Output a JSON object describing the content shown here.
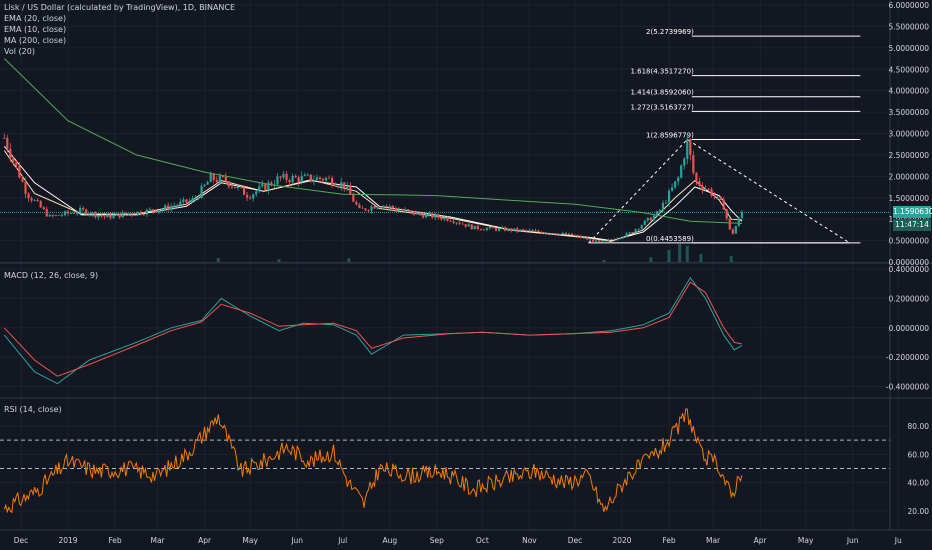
{
  "header": {
    "lines": [
      "Lisk / US Dollar (calculated by TradingView), 1D, BINANCE",
      "EMA (20, close)",
      "EMA (10, close)",
      "MA (200, close)",
      "Vol (20)"
    ]
  },
  "price_labels": {
    "last_price": "1.1590630",
    "countdown": "11:47:14"
  },
  "colors": {
    "background": "#131722",
    "grid": "#1e2230",
    "separator": "#363a45",
    "text": "#d1d4dc",
    "up": "#26a69a",
    "down": "#ef5350",
    "ema20": "#ffffff",
    "ema10": "#ffe0b2",
    "ma200": "#4caf50",
    "macd_line": "#26a69a",
    "signal_line": "#ef5350",
    "rsi_line": "#f57c00",
    "last_price_bg": "#26a69a",
    "countdown_bg": "#1e5c56"
  },
  "chart_data": [
    {
      "type": "candlestick",
      "title": "Lisk / US Dollar (calculated by TradingView), 1D, BINANCE",
      "x_tick_labels": [
        "Dec",
        "2019",
        "Feb",
        "Mar",
        "Apr",
        "May",
        "Jun",
        "Jul",
        "Aug",
        "Sep",
        "Oct",
        "Nov",
        "Dec",
        "2020",
        "Feb",
        "Mar",
        "Apr",
        "May",
        "Jun",
        "Ju"
      ],
      "y_tick_labels": [
        "6.0000000",
        "5.5000000",
        "5.0000000",
        "4.5000000",
        "4.0000000",
        "3.5000000",
        "3.0000000",
        "2.5000000",
        "2.0000000",
        "1.5000000",
        "1.0000000",
        "0.5000000",
        "0.0000000"
      ],
      "ylim": [
        0,
        6.0
      ],
      "price_path": [
        {
          "x": "2018-11-20",
          "y": 2.9
        },
        {
          "x": "2018-12-05",
          "y": 1.6
        },
        {
          "x": "2018-12-20",
          "y": 1.05
        },
        {
          "x": "2019-01-10",
          "y": 1.2
        },
        {
          "x": "2019-01-25",
          "y": 1.05
        },
        {
          "x": "2019-02-15",
          "y": 1.15
        },
        {
          "x": "2019-03-05",
          "y": 1.25
        },
        {
          "x": "2019-03-25",
          "y": 1.45
        },
        {
          "x": "2019-04-05",
          "y": 1.95
        },
        {
          "x": "2019-04-15",
          "y": 1.9
        },
        {
          "x": "2019-04-30",
          "y": 1.55
        },
        {
          "x": "2019-05-20",
          "y": 1.95
        },
        {
          "x": "2019-06-05",
          "y": 1.95
        },
        {
          "x": "2019-06-20",
          "y": 1.95
        },
        {
          "x": "2019-07-02",
          "y": 1.8
        },
        {
          "x": "2019-07-12",
          "y": 1.2
        },
        {
          "x": "2019-07-25",
          "y": 1.35
        },
        {
          "x": "2019-08-15",
          "y": 1.15
        },
        {
          "x": "2019-09-10",
          "y": 1.0
        },
        {
          "x": "2019-09-25",
          "y": 0.8
        },
        {
          "x": "2019-10-20",
          "y": 0.75
        },
        {
          "x": "2019-11-10",
          "y": 0.7
        },
        {
          "x": "2019-11-30",
          "y": 0.62
        },
        {
          "x": "2019-12-18",
          "y": 0.45
        },
        {
          "x": "2020-01-05",
          "y": 0.65
        },
        {
          "x": "2020-01-25",
          "y": 1.15
        },
        {
          "x": "2020-02-07",
          "y": 1.95
        },
        {
          "x": "2020-02-13",
          "y": 2.8
        },
        {
          "x": "2020-02-18",
          "y": 1.9
        },
        {
          "x": "2020-02-28",
          "y": 1.65
        },
        {
          "x": "2020-03-08",
          "y": 1.3
        },
        {
          "x": "2020-03-13",
          "y": 0.6
        },
        {
          "x": "2020-03-20",
          "y": 1.16
        }
      ],
      "series": [
        {
          "name": "EMA (20, close)",
          "values": [
            {
              "x": "2018-11-20",
              "y": 2.7
            },
            {
              "x": "2018-12-10",
              "y": 1.85
            },
            {
              "x": "2019-01-10",
              "y": 1.1
            },
            {
              "x": "2019-02-15",
              "y": 1.1
            },
            {
              "x": "2019-03-20",
              "y": 1.3
            },
            {
              "x": "2019-04-12",
              "y": 1.85
            },
            {
              "x": "2019-05-10",
              "y": 1.65
            },
            {
              "x": "2019-06-10",
              "y": 1.9
            },
            {
              "x": "2019-07-10",
              "y": 1.75
            },
            {
              "x": "2019-07-25",
              "y": 1.3
            },
            {
              "x": "2019-09-10",
              "y": 1.05
            },
            {
              "x": "2019-10-20",
              "y": 0.75
            },
            {
              "x": "2019-12-10",
              "y": 0.58
            },
            {
              "x": "2019-12-25",
              "y": 0.5
            },
            {
              "x": "2020-01-15",
              "y": 0.7
            },
            {
              "x": "2020-02-05",
              "y": 1.3
            },
            {
              "x": "2020-02-18",
              "y": 1.75
            },
            {
              "x": "2020-03-05",
              "y": 1.55
            },
            {
              "x": "2020-03-13",
              "y": 1.2
            },
            {
              "x": "2020-03-20",
              "y": 0.95
            }
          ]
        },
        {
          "name": "EMA (10, close)",
          "values": [
            {
              "x": "2018-11-20",
              "y": 2.6
            },
            {
              "x": "2018-12-10",
              "y": 1.6
            },
            {
              "x": "2019-01-10",
              "y": 1.12
            },
            {
              "x": "2019-02-15",
              "y": 1.12
            },
            {
              "x": "2019-03-20",
              "y": 1.35
            },
            {
              "x": "2019-04-12",
              "y": 1.9
            },
            {
              "x": "2019-05-10",
              "y": 1.65
            },
            {
              "x": "2019-06-10",
              "y": 1.92
            },
            {
              "x": "2019-07-10",
              "y": 1.65
            },
            {
              "x": "2019-07-25",
              "y": 1.25
            },
            {
              "x": "2019-09-10",
              "y": 1.02
            },
            {
              "x": "2019-10-20",
              "y": 0.74
            },
            {
              "x": "2019-12-10",
              "y": 0.56
            },
            {
              "x": "2019-12-25",
              "y": 0.48
            },
            {
              "x": "2020-01-15",
              "y": 0.75
            },
            {
              "x": "2020-02-05",
              "y": 1.5
            },
            {
              "x": "2020-02-18",
              "y": 1.9
            },
            {
              "x": "2020-03-05",
              "y": 1.45
            },
            {
              "x": "2020-03-13",
              "y": 1.0
            },
            {
              "x": "2020-03-20",
              "y": 0.98
            }
          ]
        },
        {
          "name": "MA (200, close)",
          "values": [
            {
              "x": "2018-11-20",
              "y": 4.75
            },
            {
              "x": "2019-01-01",
              "y": 3.3
            },
            {
              "x": "2019-02-15",
              "y": 2.5
            },
            {
              "x": "2019-04-01",
              "y": 2.1
            },
            {
              "x": "2019-05-15",
              "y": 1.8
            },
            {
              "x": "2019-07-01",
              "y": 1.58
            },
            {
              "x": "2019-08-01",
              "y": 1.57
            },
            {
              "x": "2019-09-01",
              "y": 1.55
            },
            {
              "x": "2019-10-15",
              "y": 1.45
            },
            {
              "x": "2019-12-01",
              "y": 1.35
            },
            {
              "x": "2020-01-15",
              "y": 1.15
            },
            {
              "x": "2020-02-15",
              "y": 0.95
            },
            {
              "x": "2020-03-20",
              "y": 0.9
            }
          ]
        }
      ],
      "volume_bars": [
        {
          "x": "2019-04-10",
          "y": 0.1
        },
        {
          "x": "2019-05-20",
          "y": 0.07
        },
        {
          "x": "2019-07-05",
          "y": 0.09
        },
        {
          "x": "2019-12-20",
          "y": 0.05
        },
        {
          "x": "2020-01-20",
          "y": 0.12
        },
        {
          "x": "2020-02-01",
          "y": 0.3
        },
        {
          "x": "2020-02-08",
          "y": 0.45
        },
        {
          "x": "2020-02-13",
          "y": 0.4
        },
        {
          "x": "2020-02-22",
          "y": 0.2
        },
        {
          "x": "2020-03-13",
          "y": 0.15
        }
      ],
      "horizontal_levels": [
        {
          "label": "2(5.2739969)",
          "y": 5.2739969
        },
        {
          "label": "1.618(4.3517270)",
          "y": 4.351727
        },
        {
          "label": "1.414(3.8592060)",
          "y": 3.859206
        },
        {
          "label": "1.272(3.5163727)",
          "y": 3.5163727
        },
        {
          "label": "1(2.8596779)",
          "y": 2.8596779
        },
        {
          "label": "0(0.4453589)",
          "y": 0.4453589
        }
      ],
      "last_price": 1.159063,
      "countdown": "11:47:14"
    },
    {
      "type": "line",
      "title": "MACD (12, 26, close, 9)",
      "y_tick_labels": [
        "0.4000000",
        "0.2000000",
        "0.0000000",
        "-0.2000000",
        "-0.4000000"
      ],
      "ylim": [
        -0.45,
        0.4
      ],
      "series": [
        {
          "name": "MACD",
          "values": [
            {
              "x": "2018-11-20",
              "y": -0.05
            },
            {
              "x": "2018-12-10",
              "y": -0.3
            },
            {
              "x": "2018-12-25",
              "y": -0.38
            },
            {
              "x": "2019-01-15",
              "y": -0.22
            },
            {
              "x": "2019-02-15",
              "y": -0.1
            },
            {
              "x": "2019-03-10",
              "y": 0.0
            },
            {
              "x": "2019-03-30",
              "y": 0.05
            },
            {
              "x": "2019-04-12",
              "y": 0.2
            },
            {
              "x": "2019-05-01",
              "y": 0.08
            },
            {
              "x": "2019-05-20",
              "y": -0.02
            },
            {
              "x": "2019-06-05",
              "y": 0.03
            },
            {
              "x": "2019-06-25",
              "y": 0.02
            },
            {
              "x": "2019-07-10",
              "y": -0.05
            },
            {
              "x": "2019-07-20",
              "y": -0.18
            },
            {
              "x": "2019-08-10",
              "y": -0.05
            },
            {
              "x": "2019-09-10",
              "y": -0.04
            },
            {
              "x": "2019-10-01",
              "y": -0.03
            },
            {
              "x": "2019-11-01",
              "y": -0.05
            },
            {
              "x": "2019-12-01",
              "y": -0.04
            },
            {
              "x": "2019-12-25",
              "y": -0.02
            },
            {
              "x": "2020-01-15",
              "y": 0.02
            },
            {
              "x": "2020-02-01",
              "y": 0.1
            },
            {
              "x": "2020-02-15",
              "y": 0.34
            },
            {
              "x": "2020-02-25",
              "y": 0.2
            },
            {
              "x": "2020-03-08",
              "y": -0.05
            },
            {
              "x": "2020-03-15",
              "y": -0.15
            },
            {
              "x": "2020-03-20",
              "y": -0.12
            }
          ]
        },
        {
          "name": "Signal",
          "values": [
            {
              "x": "2018-11-20",
              "y": 0.0
            },
            {
              "x": "2018-12-10",
              "y": -0.22
            },
            {
              "x": "2018-12-25",
              "y": -0.33
            },
            {
              "x": "2019-01-15",
              "y": -0.25
            },
            {
              "x": "2019-02-15",
              "y": -0.12
            },
            {
              "x": "2019-03-10",
              "y": -0.02
            },
            {
              "x": "2019-03-30",
              "y": 0.04
            },
            {
              "x": "2019-04-12",
              "y": 0.16
            },
            {
              "x": "2019-05-01",
              "y": 0.1
            },
            {
              "x": "2019-05-20",
              "y": 0.01
            },
            {
              "x": "2019-06-05",
              "y": 0.02
            },
            {
              "x": "2019-06-25",
              "y": 0.03
            },
            {
              "x": "2019-07-10",
              "y": -0.02
            },
            {
              "x": "2019-07-20",
              "y": -0.14
            },
            {
              "x": "2019-08-10",
              "y": -0.07
            },
            {
              "x": "2019-09-10",
              "y": -0.04
            },
            {
              "x": "2019-10-01",
              "y": -0.03
            },
            {
              "x": "2019-11-01",
              "y": -0.05
            },
            {
              "x": "2019-12-01",
              "y": -0.04
            },
            {
              "x": "2019-12-25",
              "y": -0.03
            },
            {
              "x": "2020-01-15",
              "y": 0.0
            },
            {
              "x": "2020-02-01",
              "y": 0.07
            },
            {
              "x": "2020-02-15",
              "y": 0.31
            },
            {
              "x": "2020-02-25",
              "y": 0.24
            },
            {
              "x": "2020-03-08",
              "y": 0.0
            },
            {
              "x": "2020-03-15",
              "y": -0.1
            },
            {
              "x": "2020-03-20",
              "y": -0.11
            }
          ]
        }
      ]
    },
    {
      "type": "line",
      "title": "RSI (14, close)",
      "y_tick_labels": [
        "80.00",
        "60.00",
        "40.00",
        "20.00"
      ],
      "ylim": [
        10,
        95
      ],
      "bands": [
        70,
        50
      ],
      "series": [
        {
          "name": "RSI",
          "values": [
            {
              "x": "2018-11-20",
              "y": 22
            },
            {
              "x": "2018-12-10",
              "y": 33
            },
            {
              "x": "2019-01-01",
              "y": 55
            },
            {
              "x": "2019-01-20",
              "y": 48
            },
            {
              "x": "2019-02-10",
              "y": 50
            },
            {
              "x": "2019-03-01",
              "y": 45
            },
            {
              "x": "2019-03-20",
              "y": 60
            },
            {
              "x": "2019-04-01",
              "y": 75
            },
            {
              "x": "2019-04-10",
              "y": 87
            },
            {
              "x": "2019-04-25",
              "y": 48
            },
            {
              "x": "2019-05-10",
              "y": 55
            },
            {
              "x": "2019-05-25",
              "y": 65
            },
            {
              "x": "2019-06-10",
              "y": 55
            },
            {
              "x": "2019-06-25",
              "y": 62
            },
            {
              "x": "2019-07-05",
              "y": 40
            },
            {
              "x": "2019-07-15",
              "y": 25
            },
            {
              "x": "2019-07-25",
              "y": 50
            },
            {
              "x": "2019-08-15",
              "y": 45
            },
            {
              "x": "2019-09-05",
              "y": 48
            },
            {
              "x": "2019-09-25",
              "y": 35
            },
            {
              "x": "2019-10-15",
              "y": 42
            },
            {
              "x": "2019-11-05",
              "y": 48
            },
            {
              "x": "2019-11-25",
              "y": 40
            },
            {
              "x": "2019-12-10",
              "y": 45
            },
            {
              "x": "2019-12-20",
              "y": 20
            },
            {
              "x": "2020-01-05",
              "y": 45
            },
            {
              "x": "2020-01-25",
              "y": 62
            },
            {
              "x": "2020-02-05",
              "y": 75
            },
            {
              "x": "2020-02-13",
              "y": 90
            },
            {
              "x": "2020-02-22",
              "y": 60
            },
            {
              "x": "2020-03-05",
              "y": 52
            },
            {
              "x": "2020-03-13",
              "y": 30
            },
            {
              "x": "2020-03-20",
              "y": 50
            }
          ]
        }
      ]
    }
  ]
}
